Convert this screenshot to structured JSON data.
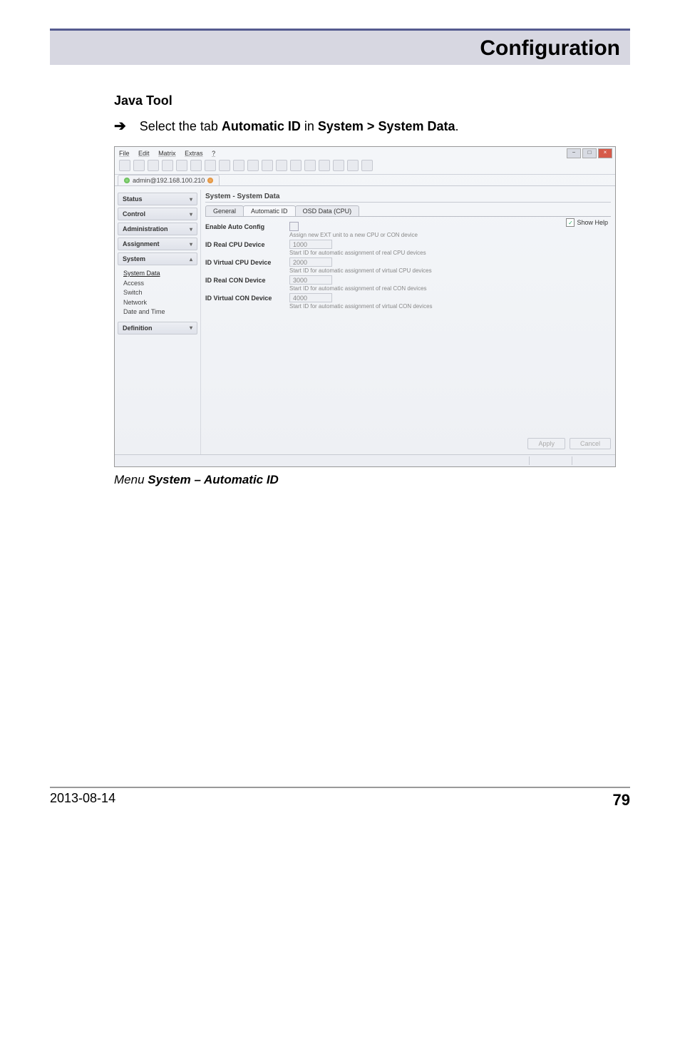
{
  "header": {
    "title": "Configuration"
  },
  "section": {
    "subhead": "Java Tool",
    "step_prefix": "Select the tab ",
    "step_b1": "Automatic ID",
    "step_mid": " in ",
    "step_b2": "System > System Data",
    "step_suffix": "."
  },
  "caption": {
    "prefix": "Menu ",
    "bold": "System – Automatic ID"
  },
  "footer": {
    "date": "2013-08-14",
    "page": "79"
  },
  "app": {
    "menus": [
      "File",
      "Edit",
      "Matrix",
      "Extras",
      "?"
    ],
    "connection": "admin@192.168.100.210",
    "sidebar": {
      "sections": [
        {
          "label": "Status"
        },
        {
          "label": "Control"
        },
        {
          "label": "Administration"
        },
        {
          "label": "Assignment"
        },
        {
          "label": "System",
          "expanded": true,
          "items": [
            "System Data",
            "Access",
            "Switch",
            "Network",
            "Date and Time"
          ]
        },
        {
          "label": "Definition"
        }
      ]
    },
    "content": {
      "title": "System - System Data",
      "tabs": [
        "General",
        "Automatic ID",
        "OSD Data (CPU)"
      ],
      "show_help": "Show Help",
      "fields": {
        "enable_auto": {
          "label": "Enable Auto Config",
          "hint": "Assign new EXT unit to a new CPU or CON device"
        },
        "id_real_cpu": {
          "label": "ID Real CPU Device",
          "value": "1000",
          "hint": "Start ID for automatic assignment of real CPU devices"
        },
        "id_virtual_cpu": {
          "label": "ID Virtual CPU Device",
          "value": "2000",
          "hint": "Start ID for automatic assignment of virtual CPU devices"
        },
        "id_real_con": {
          "label": "ID Real CON Device",
          "value": "3000",
          "hint": "Start ID for automatic assignment of real CON devices"
        },
        "id_virtual_con": {
          "label": "ID Virtual CON Device",
          "value": "4000",
          "hint": "Start ID for automatic assignment of virtual CON devices"
        }
      },
      "buttons": {
        "apply": "Apply",
        "cancel": "Cancel"
      }
    }
  }
}
